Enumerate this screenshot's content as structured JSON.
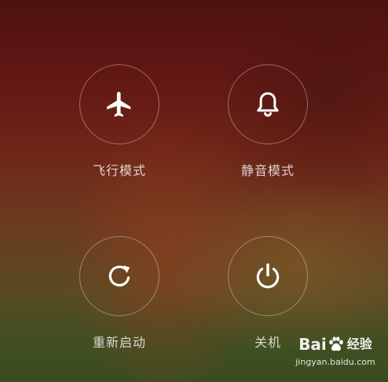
{
  "power_menu": {
    "items": [
      {
        "label": "飞行模式",
        "icon": "airplane-icon"
      },
      {
        "label": "静音模式",
        "icon": "bell-icon"
      },
      {
        "label": "重新启动",
        "icon": "reboot-icon"
      },
      {
        "label": "关机",
        "icon": "power-icon"
      }
    ]
  },
  "watermark": {
    "logo_left": "Bai",
    "logo_right": "经验",
    "url": "jingyan.baidu.com"
  },
  "colors": {
    "icon": "#ffffff",
    "label": "#e6e0dc",
    "circle_border": "#ffffff59"
  }
}
